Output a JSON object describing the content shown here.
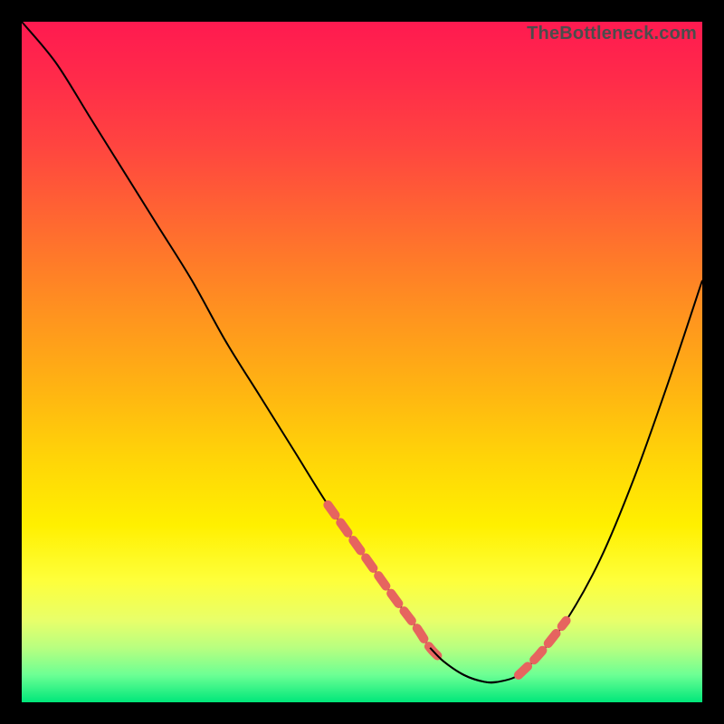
{
  "watermark": "TheBottleneck.com",
  "chart_data": {
    "type": "line",
    "title": "",
    "xlabel": "",
    "ylabel": "",
    "xlim": [
      0,
      100
    ],
    "ylim": [
      0,
      100
    ],
    "grid": false,
    "legend": false,
    "series": [
      {
        "name": "bottleneck-curve",
        "x": [
          0,
          5,
          10,
          15,
          20,
          25,
          30,
          35,
          40,
          45,
          50,
          55,
          58,
          60,
          62,
          65,
          68,
          70,
          73,
          76,
          80,
          85,
          90,
          95,
          100
        ],
        "y": [
          100,
          94,
          86,
          78,
          70,
          62,
          53,
          45,
          37,
          29,
          22,
          15,
          11,
          8,
          6,
          4,
          3,
          3,
          4,
          7,
          12,
          21,
          33,
          47,
          62
        ]
      }
    ],
    "highlight_regions": [
      {
        "name": "left-highlight",
        "x_start": 44,
        "x_end": 62
      },
      {
        "name": "right-highlight",
        "x_start": 72,
        "x_end": 80
      }
    ],
    "colors": {
      "curve": "#000000",
      "highlight": "#e6645f",
      "gradient_top": "#ff1a50",
      "gradient_bottom": "#00e77a",
      "frame": "#000000"
    }
  }
}
